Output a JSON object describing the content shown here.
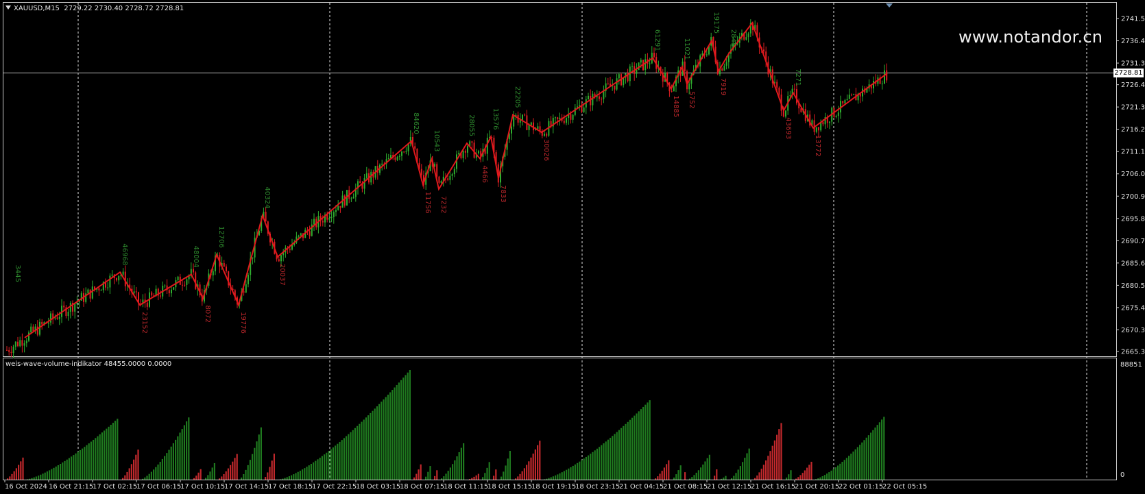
{
  "header": {
    "symbol": "XAUUSD,M15",
    "ohlc": "2729.22 2730.40 2728.72 2728.81"
  },
  "watermark": "www.notandor.cn",
  "indicator": {
    "label": "weis-wave-volume-indikator 48455.0000 0.0000",
    "scale_top": "88851",
    "scale_bottom": "0"
  },
  "current_price": "2728.81",
  "colors": {
    "background": "#000000",
    "bull": "#1f7a1f",
    "bear": "#c0282c",
    "zigzag": "#e0181c",
    "grid": "#ffffff",
    "label_up": "#2e8b2e",
    "label_down": "#c0282c"
  },
  "chart_data": {
    "type": "candlestick",
    "title": "XAUUSD,M15",
    "price_axis": [
      "2741.55",
      "2736.45",
      "2731.35",
      "2726.40",
      "2721.30",
      "2716.20",
      "2711.10",
      "2706.00",
      "2700.90",
      "2695.80",
      "2690.70",
      "2685.60",
      "2680.50",
      "2675.40",
      "2670.30",
      "2665.35"
    ],
    "price_range": [
      2665.35,
      2741.55
    ],
    "time_axis": [
      "16 Oct 2024",
      "16 Oct 21:15",
      "17 Oct 02:15",
      "17 Oct 06:15",
      "17 Oct 10:15",
      "17 Oct 14:15",
      "17 Oct 18:15",
      "17 Oct 22:15",
      "18 Oct 03:15",
      "18 Oct 07:15",
      "18 Oct 11:15",
      "18 Oct 15:15",
      "18 Oct 19:15",
      "18 Oct 23:15",
      "21 Oct 04:15",
      "21 Oct 08:15",
      "21 Oct 12:15",
      "21 Oct 16:15",
      "21 Oct 20:15",
      "22 Oct 01:15",
      "22 Oct 05:15"
    ],
    "zigzag_points": [
      {
        "price": 2668.5,
        "label": ""
      },
      {
        "price": 2683.5,
        "label": "46968"
      },
      {
        "price": 2676.0,
        "label": "23152"
      },
      {
        "price": 2683.0,
        "label": "48004"
      },
      {
        "price": 2677.5,
        "label": "8072"
      },
      {
        "price": 2687.5,
        "label": "12706"
      },
      {
        "price": 2676.0,
        "label": "19776"
      },
      {
        "price": 2696.5,
        "label": "40324"
      },
      {
        "price": 2687.0,
        "label": "20037"
      },
      {
        "price": 2713.5,
        "label": "84620"
      },
      {
        "price": 2703.5,
        "label": "11756"
      },
      {
        "price": 2709.5,
        "label": "10543"
      },
      {
        "price": 2702.5,
        "label": "7232"
      },
      {
        "price": 2713.0,
        "label": "28055"
      },
      {
        "price": 2709.5,
        "label": "4466"
      },
      {
        "price": 2714.5,
        "label": "13576"
      },
      {
        "price": 2705.0,
        "label": "7833"
      },
      {
        "price": 2719.5,
        "label": "22205"
      },
      {
        "price": 2715.5,
        "label": "30026"
      },
      {
        "price": 2732.5,
        "label": "61291"
      },
      {
        "price": 2725.5,
        "label": "14885"
      },
      {
        "price": 2730.5,
        "label": "11021"
      },
      {
        "price": 2726.5,
        "label": "5752"
      },
      {
        "price": 2736.5,
        "label": "19175"
      },
      {
        "price": 2729.5,
        "label": "7919"
      },
      {
        "price": 2733.5,
        "label": "2845"
      },
      {
        "price": 2740.5,
        "label": ""
      },
      {
        "price": 2720.5,
        "label": "43693"
      },
      {
        "price": 2724.5,
        "label": "7271"
      },
      {
        "price": 2716.5,
        "label": "13772"
      },
      {
        "price": 2729.0,
        "label": ""
      }
    ],
    "side_label": "3445",
    "volume_waves": [
      {
        "dir": "down",
        "peak": 17000
      },
      {
        "dir": "up",
        "peak": 46968
      },
      {
        "dir": "down",
        "peak": 23152
      },
      {
        "dir": "up",
        "peak": 48004
      },
      {
        "dir": "down",
        "peak": 8072
      },
      {
        "dir": "up",
        "peak": 12706
      },
      {
        "dir": "down",
        "peak": 19776
      },
      {
        "dir": "up",
        "peak": 40324
      },
      {
        "dir": "down",
        "peak": 20037
      },
      {
        "dir": "up",
        "peak": 84620
      },
      {
        "dir": "down",
        "peak": 11756
      },
      {
        "dir": "up",
        "peak": 10543
      },
      {
        "dir": "down",
        "peak": 7232
      },
      {
        "dir": "up",
        "peak": 28055
      },
      {
        "dir": "down",
        "peak": 4466
      },
      {
        "dir": "up",
        "peak": 13576
      },
      {
        "dir": "down",
        "peak": 7833
      },
      {
        "dir": "up",
        "peak": 22205
      },
      {
        "dir": "down",
        "peak": 30026
      },
      {
        "dir": "up",
        "peak": 61291
      },
      {
        "dir": "down",
        "peak": 14885
      },
      {
        "dir": "up",
        "peak": 11021
      },
      {
        "dir": "down",
        "peak": 5752
      },
      {
        "dir": "up",
        "peak": 19175
      },
      {
        "dir": "down",
        "peak": 7919
      },
      {
        "dir": "up",
        "peak": 2845
      },
      {
        "dir": "up",
        "peak": 24000
      },
      {
        "dir": "down",
        "peak": 43693
      },
      {
        "dir": "up",
        "peak": 7271
      },
      {
        "dir": "down",
        "peak": 13772
      },
      {
        "dir": "up",
        "peak": 48455
      }
    ],
    "volume_range": [
      0,
      88851
    ]
  }
}
